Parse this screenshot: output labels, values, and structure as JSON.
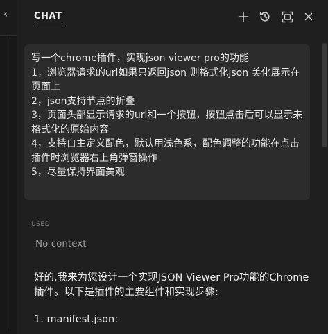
{
  "header": {
    "tab_label": "CHAT",
    "icons": [
      "plus-icon",
      "history-icon",
      "maximize-icon",
      "close-icon"
    ]
  },
  "left_strip": {
    "chevron": "‹"
  },
  "prompt": {
    "lines": [
      "写一个chrome插件，实现json viewer pro的功能",
      "1，浏览器请求的url如果只返回json 则格式化json 美化展示在页面上",
      "2，json支持节点的折叠",
      "3，页面头部显示请求的url和一个按钮，按钮点击后可以显示未格式化的原始内容",
      "4，支持自主定义配色，默认用浅色系，配色调整的功能在点击插件时浏览器右上角弹窗操作",
      "5，尽量保持界面美观"
    ]
  },
  "context": {
    "used_label": "USED",
    "value": "No context"
  },
  "reply": {
    "lines": [
      "好的,我来为您设计一个实现JSON Viewer Pro功能的Chrome插件。以下是插件的主要组件和实现步骤:"
    ],
    "step": "1. manifest.json:"
  },
  "colors": {
    "background": "#1f1f20",
    "bubble": "#2c2c2d",
    "text": "#e8e8e8",
    "muted": "#9a9a9a"
  }
}
